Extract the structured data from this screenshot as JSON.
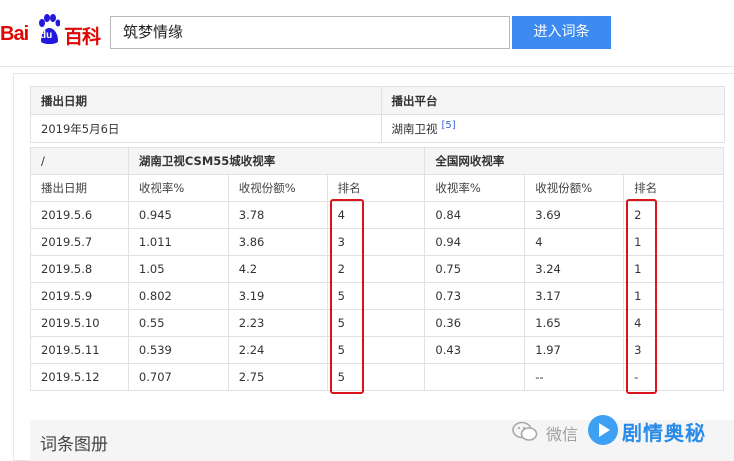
{
  "header": {
    "logo_bai": "Bai",
    "logo_du": "du",
    "logo_baike": "百科",
    "search_value": "筑梦情缘",
    "enter_button": "进入词条"
  },
  "info_table": {
    "col1_header": "播出日期",
    "col2_header": "播出平台",
    "date": "2019年5月6日",
    "platform": "湖南卫视",
    "ref": "[5]"
  },
  "ratings": {
    "corner": "/",
    "group1": "湖南卫视CSM55城收视率",
    "group2": "全国网收视率",
    "columns": [
      "播出日期",
      "收视率%",
      "收视份额%",
      "排名",
      "收视率%",
      "收视份额%",
      "排名"
    ],
    "rows": [
      [
        "2019.5.6",
        "0.945",
        "3.78",
        "4",
        "0.84",
        "3.69",
        "2"
      ],
      [
        "2019.5.7",
        "1.011",
        "3.86",
        "3",
        "0.94",
        "4",
        "1"
      ],
      [
        "2019.5.8",
        "1.05",
        "4.2",
        "2",
        "0.75",
        "3.24",
        "1"
      ],
      [
        "2019.5.9",
        "0.802",
        "3.19",
        "5",
        "0.73",
        "3.17",
        "1"
      ],
      [
        "2019.5.10",
        "0.55",
        "2.23",
        "5",
        "0.36",
        "1.65",
        "4"
      ],
      [
        "2019.5.11",
        "0.539",
        "2.24",
        "5",
        "0.43",
        "1.97",
        "3"
      ],
      [
        "2019.5.12",
        "0.707",
        "2.75",
        "5",
        "",
        "--",
        "-"
      ]
    ]
  },
  "section_title": "词条图册",
  "watermark": {
    "text1": "微信",
    "text2": "剧情奥秘"
  },
  "colors": {
    "baidu_red": "#e10602",
    "button_blue": "#3d8af0",
    "highlight_red": "#d9151b"
  }
}
